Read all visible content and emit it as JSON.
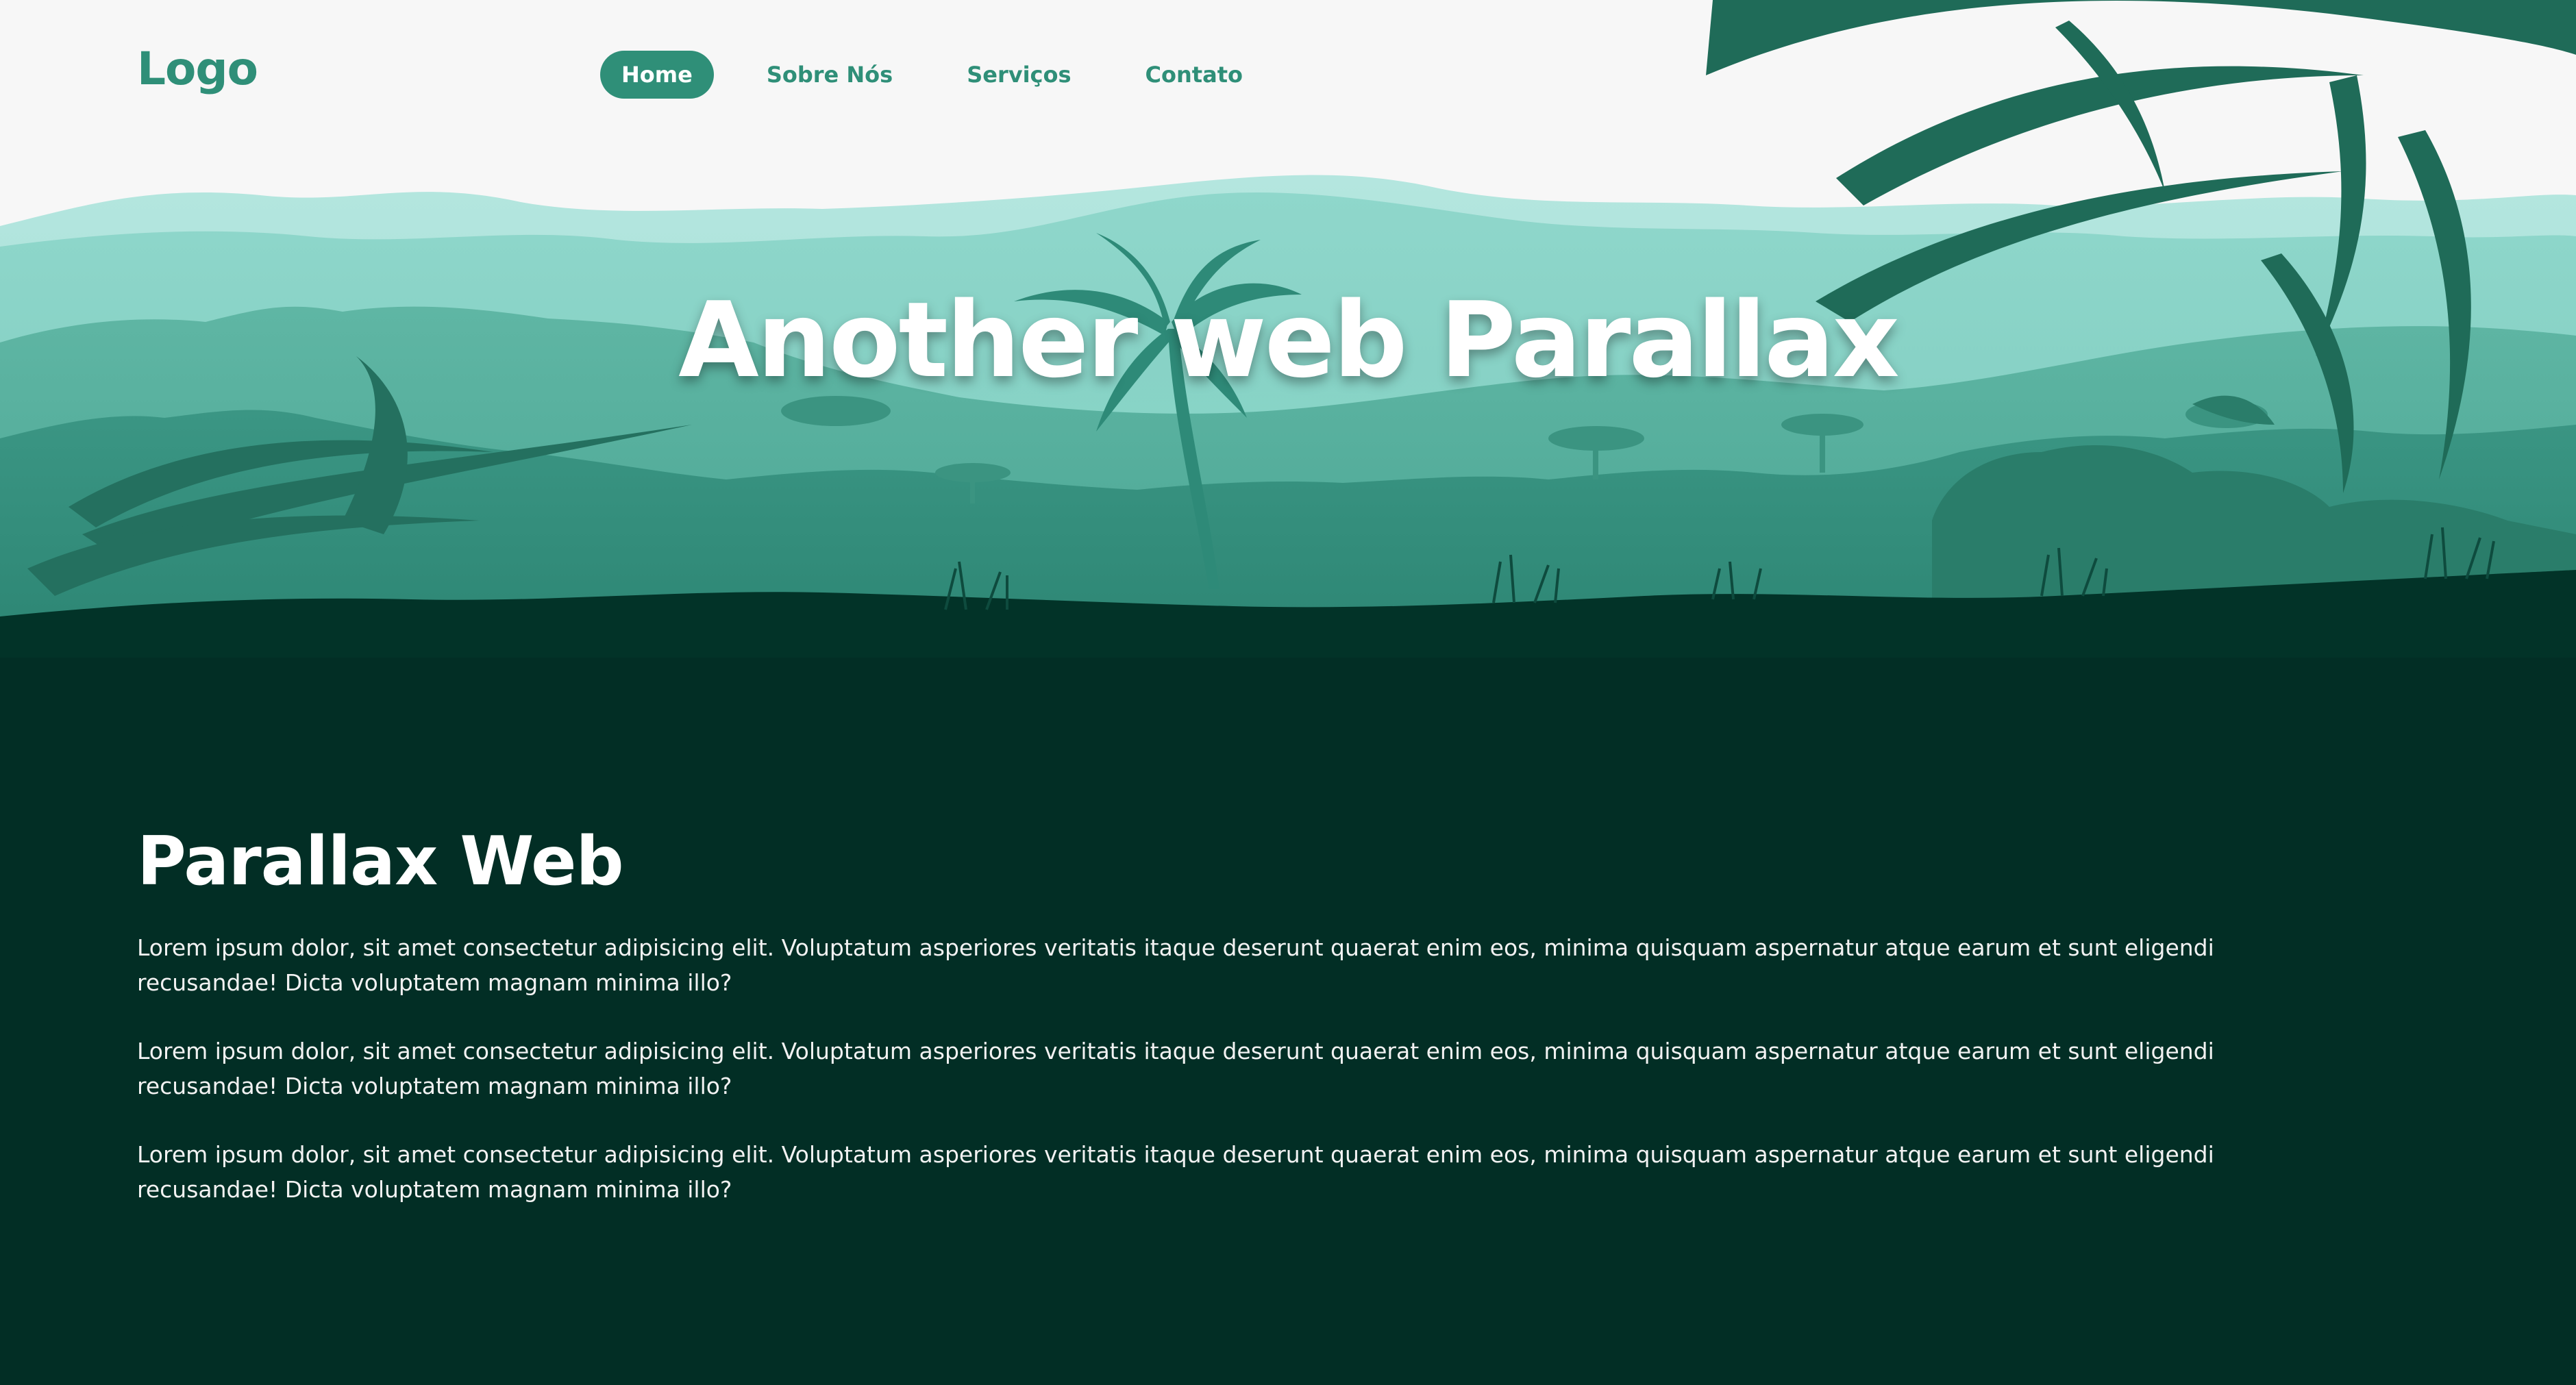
{
  "nav": {
    "logo": "Logo",
    "links": [
      {
        "label": "Home",
        "active": true
      },
      {
        "label": "Sobre Nós",
        "active": false
      },
      {
        "label": "Serviços",
        "active": false
      },
      {
        "label": "Contato",
        "active": false
      }
    ]
  },
  "hero": {
    "title": "Another web Parallax"
  },
  "section": {
    "heading": "Parallax Web",
    "paragraphs": [
      "Lorem ipsum dolor, sit amet consectetur adipisicing elit. Voluptatum asperiores veritatis itaque deserunt quaerat enim eos, minima quisquam aspernatur atque earum et sunt eligendi recusandae! Dicta voluptatem magnam minima illo?",
      "Lorem ipsum dolor, sit amet consectetur adipisicing elit. Voluptatum asperiores veritatis itaque deserunt quaerat enim eos, minima quisquam aspernatur atque earum et sunt eligendi recusandae! Dicta voluptatem magnam minima illo?",
      "Lorem ipsum dolor, sit amet consectetur adipisicing elit. Voluptatum asperiores veritatis itaque deserunt quaerat enim eos, minima quisquam aspernatur atque earum et sunt eligendi recusandae! Dicta voluptatem magnam minima illo?"
    ]
  },
  "colors": {
    "accent": "#2f8f78",
    "background_dark": "#022e25",
    "sky": "#f7f7f7"
  }
}
